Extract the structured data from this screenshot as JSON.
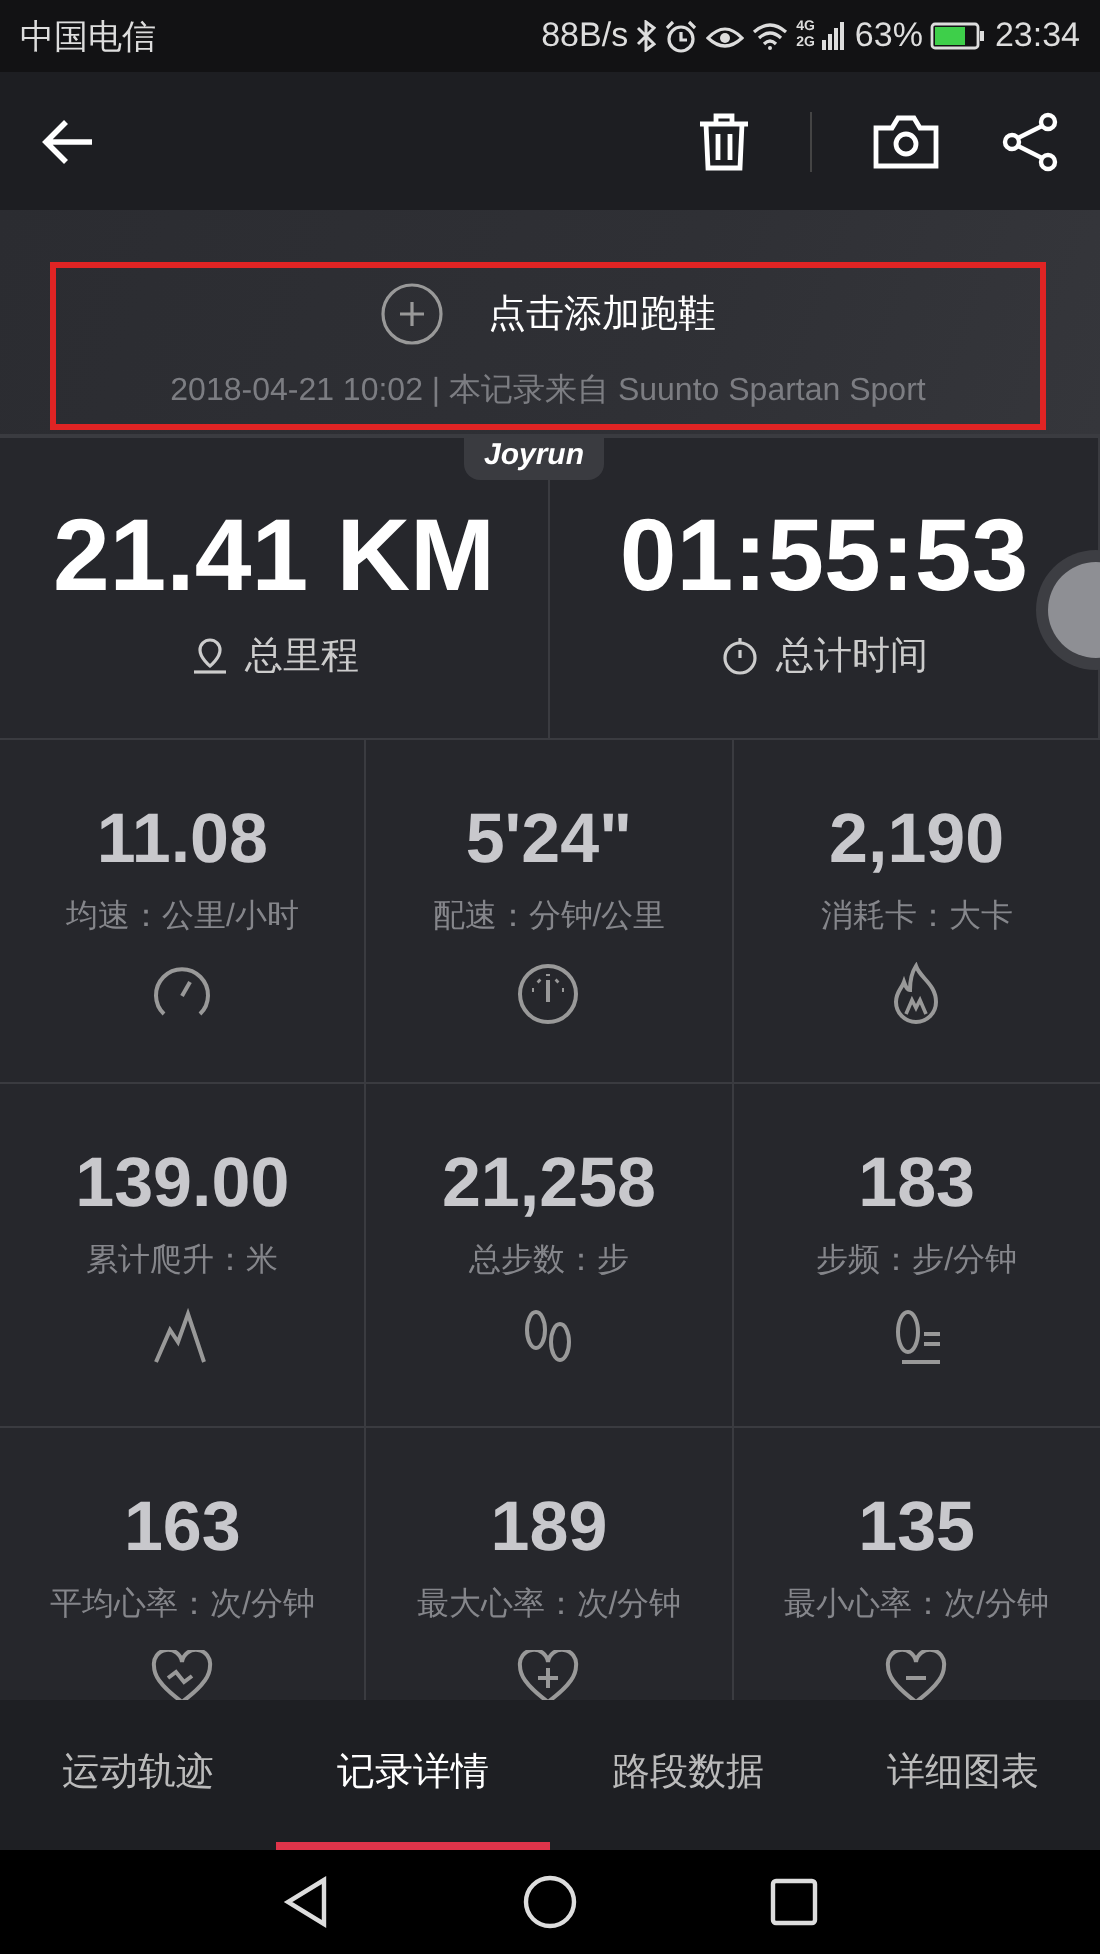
{
  "status_bar": {
    "carrier": "中国电信",
    "speed": "88B/s",
    "network": [
      "4G",
      "2G"
    ],
    "battery": "63%",
    "time": "23:34"
  },
  "header": {
    "add_shoe": "点击添加跑鞋",
    "record_info": "2018-04-21 10:02 | 本记录来自 Suunto Spartan Sport",
    "badge": "Joyrun"
  },
  "summary": [
    {
      "kind": "distance",
      "value": "21.41 KM",
      "label": "总里程"
    },
    {
      "kind": "time",
      "value": "01:55:53",
      "label": "总计时间"
    }
  ],
  "stats": [
    {
      "kind": "speed",
      "value": "11.08",
      "label": "均速：公里/小时"
    },
    {
      "kind": "pace",
      "value": "5'24\"",
      "label": "配速：分钟/公里"
    },
    {
      "kind": "calories",
      "value": "2,190",
      "label": "消耗卡：大卡"
    },
    {
      "kind": "climb",
      "value": "139.00",
      "label": "累计爬升：米"
    },
    {
      "kind": "steps",
      "value": "21,258",
      "label": "总步数：步"
    },
    {
      "kind": "cadence",
      "value": "183",
      "label": "步频：步/分钟"
    },
    {
      "kind": "heart_avg",
      "value": "163",
      "label": "平均心率：次/分钟"
    },
    {
      "kind": "heart_max",
      "value": "189",
      "label": "最大心率：次/分钟"
    },
    {
      "kind": "heart_min",
      "value": "135",
      "label": "最小心率：次/分钟"
    }
  ],
  "tabs": [
    {
      "label": "运动轨迹",
      "selected": false
    },
    {
      "label": "记录详情",
      "selected": true
    },
    {
      "label": "路段数据",
      "selected": false
    },
    {
      "label": "详细图表",
      "selected": false
    }
  ]
}
